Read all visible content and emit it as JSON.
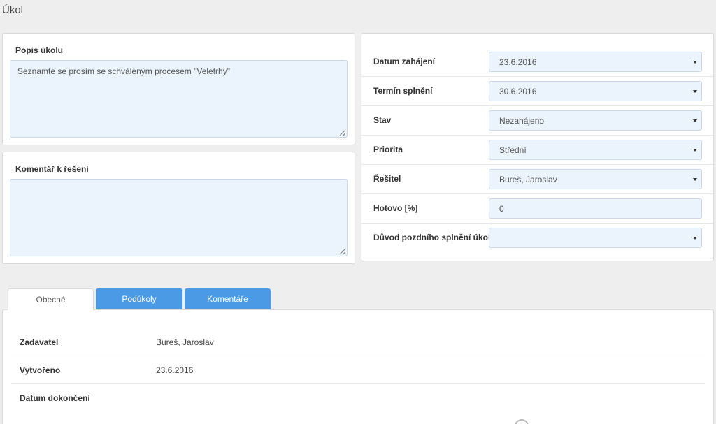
{
  "page": {
    "title": "Úkol"
  },
  "description": {
    "label": "Popis úkolu",
    "value": "Seznamte se prosím se schváleným procesem \"Veletrhy\""
  },
  "comment": {
    "label": "Komentář k řešení",
    "value": ""
  },
  "fields": [
    {
      "label": "Datum zahájení",
      "value": "23.6.2016",
      "type": "select"
    },
    {
      "label": "Termín splnění",
      "value": "30.6.2016",
      "type": "select"
    },
    {
      "label": "Stav",
      "value": "Nezahájeno",
      "type": "select"
    },
    {
      "label": "Priorita",
      "value": "Střední",
      "type": "select"
    },
    {
      "label": "Řešitel",
      "value": "Bureš, Jaroslav",
      "type": "select"
    },
    {
      "label": "Hotovo [%]",
      "value": "0",
      "type": "input"
    },
    {
      "label": "Důvod pozdního splnění úkolu",
      "value": "",
      "type": "select"
    }
  ],
  "tabs": {
    "general": "Obecné",
    "subtasks": "Podúkoly",
    "comments": "Komentáře"
  },
  "info": [
    {
      "label": "Zadavatel",
      "value": "Bureš, Jaroslav"
    },
    {
      "label": "Vytvořeno",
      "value": "23.6.2016"
    },
    {
      "label": "Datum dokončení",
      "value": ""
    }
  ],
  "colors": {
    "accent": "#4a9ae6",
    "field_bg": "#ebf3fd",
    "page_bg": "#eeeeee"
  }
}
